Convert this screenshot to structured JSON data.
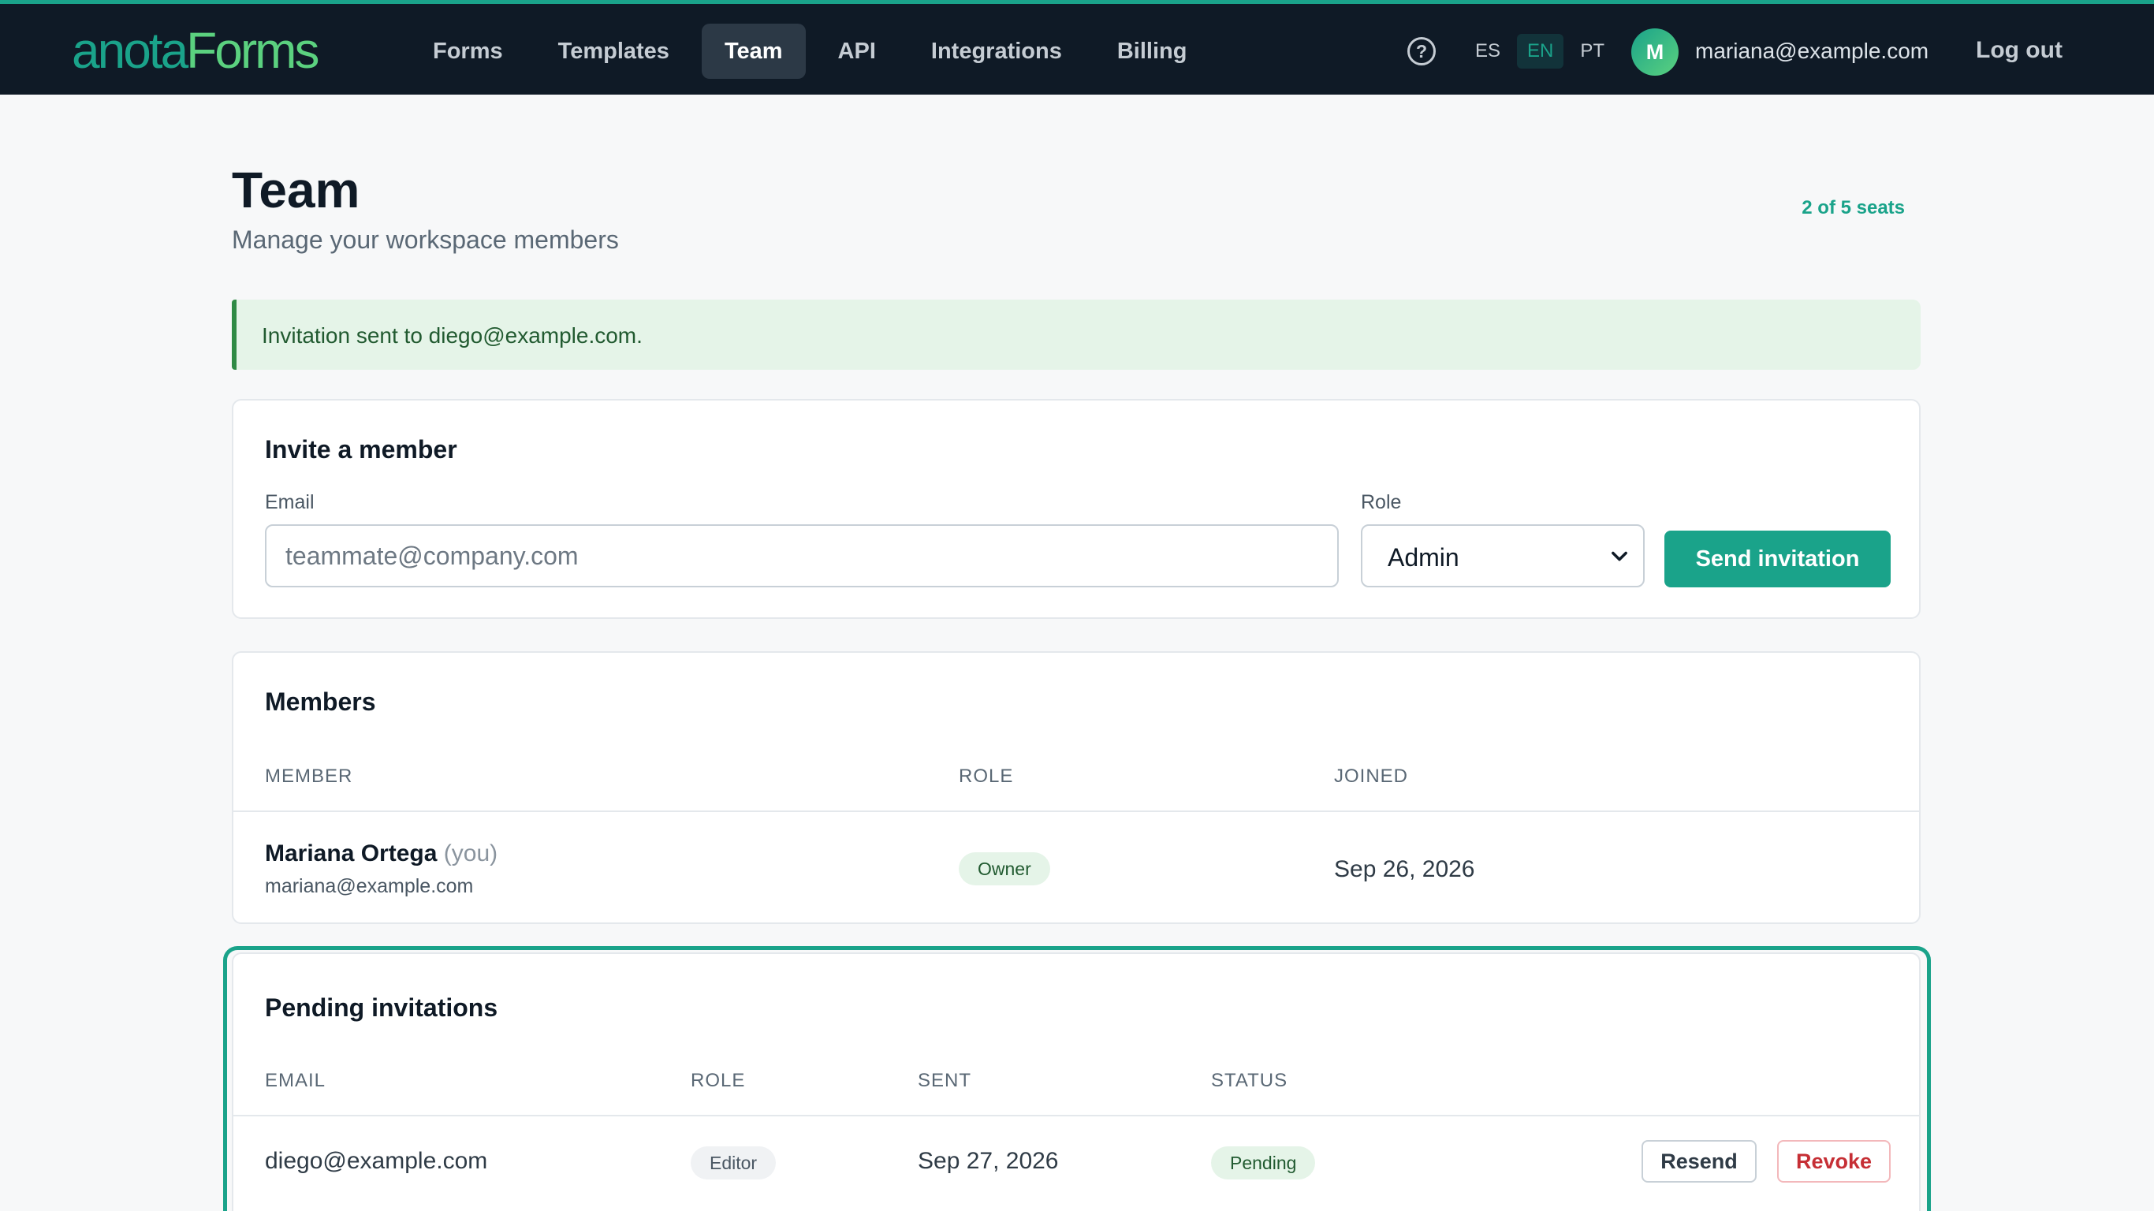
{
  "brand": {
    "logo_part1": "anota",
    "logo_part2": "Forms"
  },
  "nav": {
    "items": [
      {
        "label": "Forms"
      },
      {
        "label": "Templates"
      },
      {
        "label": "Team",
        "active": true
      },
      {
        "label": "API"
      },
      {
        "label": "Integrations"
      },
      {
        "label": "Billing"
      }
    ]
  },
  "header": {
    "help_glyph": "?",
    "languages": [
      {
        "code": "ES"
      },
      {
        "code": "EN",
        "active": true
      },
      {
        "code": "PT"
      }
    ],
    "avatar_initial": "M",
    "user_email": "mariana@example.com",
    "logout_label": "Log out"
  },
  "page": {
    "title": "Team",
    "subtitle": "Manage your workspace members",
    "seats": "2 of 5 seats"
  },
  "alert": {
    "message": "Invitation sent to diego@example.com."
  },
  "invite": {
    "title": "Invite a member",
    "email_label": "Email",
    "email_placeholder": "teammate@company.com",
    "email_value": "",
    "role_label": "Role",
    "role_value": "Admin",
    "send_label": "Send invitation"
  },
  "members": {
    "title": "Members",
    "headers": {
      "member": "MEMBER",
      "role": "ROLE",
      "joined": "JOINED"
    },
    "rows": [
      {
        "name": "Mariana Ortega",
        "you_tag": "(you)",
        "email": "mariana@example.com",
        "role": "Owner",
        "joined": "Sep 26, 2026"
      }
    ]
  },
  "pending": {
    "title": "Pending invitations",
    "headers": {
      "email": "EMAIL",
      "role": "ROLE",
      "sent": "SENT",
      "status": "STATUS"
    },
    "rows": [
      {
        "email": "diego@example.com",
        "role": "Editor",
        "sent": "Sep 27, 2026",
        "status": "Pending",
        "resend_label": "Resend",
        "revoke_label": "Revoke"
      }
    ]
  },
  "colors": {
    "accent": "#1aa38a",
    "header_bg": "#0f1a26",
    "success_bg": "#e5f4e8",
    "danger": "#c62f35"
  },
  "icons": {
    "help": "help-circle-icon",
    "select_chevron": "chevron-down-icon"
  }
}
